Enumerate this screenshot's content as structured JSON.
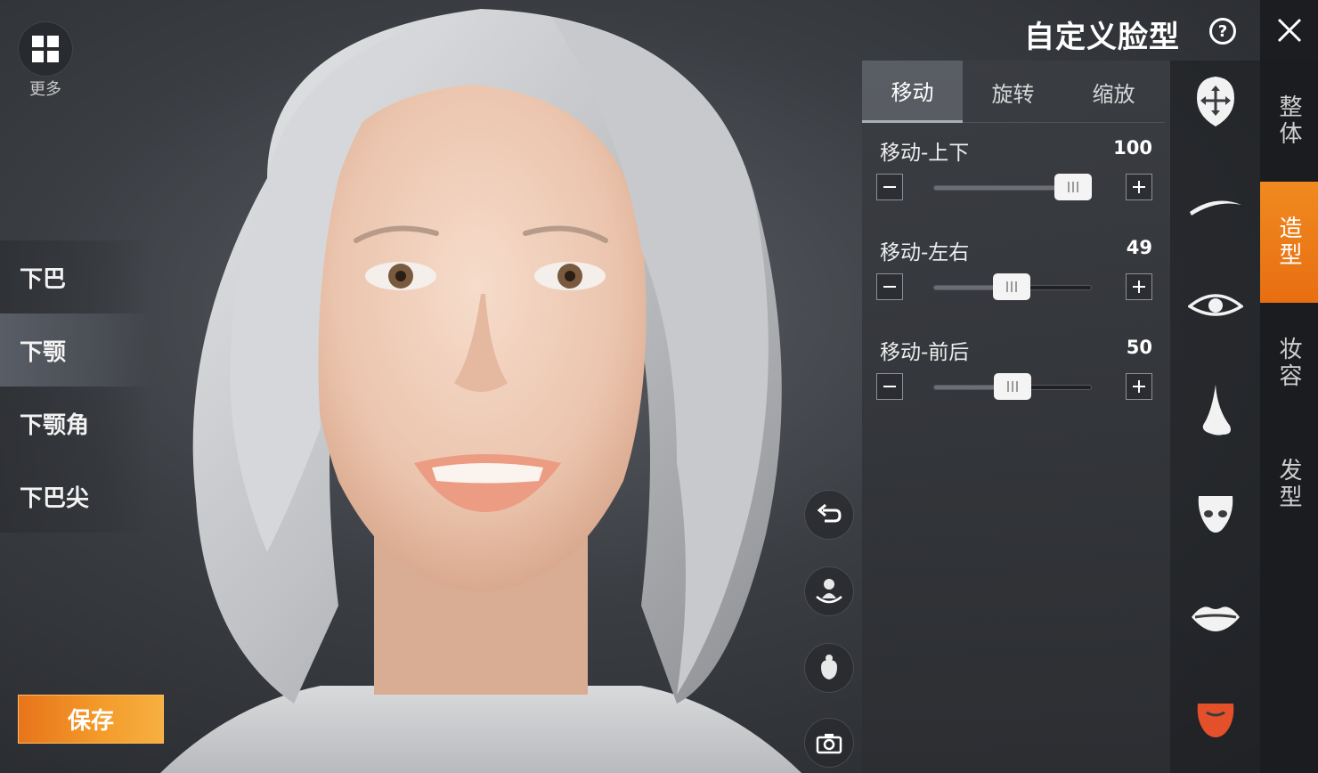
{
  "header": {
    "title": "自定义脸型",
    "help_glyph": "?"
  },
  "top_left": {
    "more_label": "更多"
  },
  "parts": [
    {
      "label": "下巴",
      "active": false
    },
    {
      "label": "下颚",
      "active": true
    },
    {
      "label": "下颚角",
      "active": false
    },
    {
      "label": "下巴尖",
      "active": false
    }
  ],
  "save_label": "保存",
  "tabs": [
    {
      "label": "移动",
      "active": true
    },
    {
      "label": "旋转",
      "active": false
    },
    {
      "label": "缩放",
      "active": false
    }
  ],
  "sliders": [
    {
      "label": "移动-上下",
      "value": "100",
      "level": 1.0
    },
    {
      "label": "移动-左右",
      "value": "49",
      "level": 0.49
    },
    {
      "label": "移动-前后",
      "value": "50",
      "level": 0.5
    }
  ],
  "features": [
    "face-move-icon",
    "eyebrow-icon",
    "eye-icon",
    "nose-icon",
    "nose-bottom-icon",
    "lips-icon",
    "chin-icon"
  ],
  "categories": [
    {
      "label": "整体",
      "active": false
    },
    {
      "label": "造型",
      "active": true
    },
    {
      "label": "妆容",
      "active": false
    },
    {
      "label": "发型",
      "active": false
    }
  ],
  "colors": {
    "accent": "#ec7a18",
    "chin_icon": "#e4502a"
  }
}
